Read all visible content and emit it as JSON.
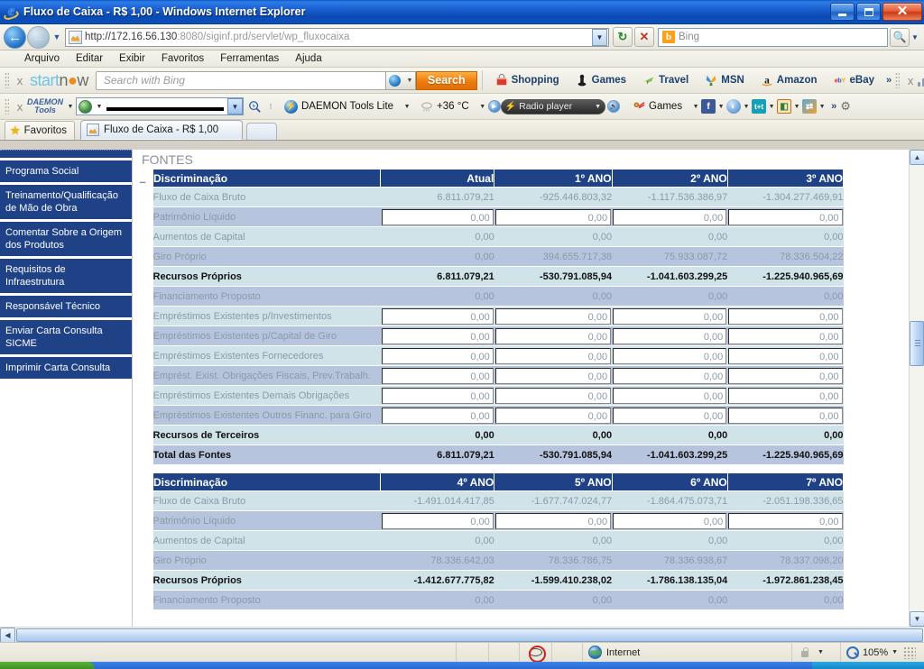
{
  "window": {
    "title": "Fluxo de Caixa - R$ 1,00 - Windows Internet Explorer",
    "minimize_label": "",
    "maximize_label": "",
    "close_label": "✕"
  },
  "address_bar": {
    "url_main": "http://172.16.56.130",
    "url_dim": ":8080/siginf.prd/servlet/wp_fluxocaixa",
    "search_placeholder": "Bing"
  },
  "menu": {
    "items": [
      "Arquivo",
      "Editar",
      "Exibir",
      "Favoritos",
      "Ferramentas",
      "Ajuda"
    ]
  },
  "toolbar_startnow": {
    "close_label": "x",
    "brand_part1": "start",
    "brand_part2": "n",
    "brand_o": "●",
    "brand_part3": "w",
    "search_placeholder": "Search with Bing",
    "search_button": "Search",
    "links": [
      {
        "label": "Shopping",
        "icon": "shopping-bag-icon"
      },
      {
        "label": "Games",
        "icon": "joystick-icon"
      },
      {
        "label": "Travel",
        "icon": "plane-icon"
      },
      {
        "label": "MSN",
        "icon": "msn-butterfly-icon"
      },
      {
        "label": "Amazon",
        "icon": "amazon-a-icon"
      },
      {
        "label": "eBay",
        "icon": "ebay-icon"
      }
    ],
    "overflow": "»",
    "right_close": "x"
  },
  "toolbar_daemon": {
    "close_label": "x",
    "brand_line1": "DAEMON",
    "brand_line2": "Tools",
    "field_value": "",
    "lite_label": "DAEMON Tools Lite",
    "temperature": "+36 °C",
    "radio_label": "Radio player",
    "games_label": "Games",
    "overflow": "»",
    "tiles": [
      "f",
      "◐",
      "t+t",
      "◧",
      "⇄"
    ]
  },
  "favorites_bar": {
    "favorites_label": "Favoritos",
    "tab_title": "Fluxo de Caixa - R$ 1,00",
    "new_tab_label": ""
  },
  "sidebar": {
    "items": [
      {
        "label": "",
        "partial": true
      },
      {
        "label": "Programa Social"
      },
      {
        "label": "Treinamento/Qualificação de Mão de Obra"
      },
      {
        "label": "Comentar Sobre a Origem dos Produtos"
      },
      {
        "label": "Requisitos de Infraestrutura"
      },
      {
        "label": "Responsável Técnico"
      },
      {
        "label": "Enviar Carta Consulta SICME"
      },
      {
        "label": "Imprimir Carta Consulta"
      }
    ]
  },
  "page": {
    "section_label": "FONTES",
    "collapse_mark": "–",
    "label_column_header": "Discriminação",
    "tables": [
      {
        "headers": [
          "Discriminação",
          "Atual",
          "1º ANO",
          "2º ANO",
          "3º ANO"
        ],
        "rows": [
          {
            "label": "Fluxo de Caixa Bruto",
            "values": [
              "6.811.079,21",
              "-925.446.803,32",
              "-1.117.536.386,97",
              "-1.304.277.469,91"
            ],
            "input": false,
            "bold": false
          },
          {
            "label": "Patrimônio Líquido",
            "values": [
              "0,00",
              "0,00",
              "0,00",
              "0,00"
            ],
            "input": true,
            "bold": false
          },
          {
            "label": "Aumentos de Capital",
            "values": [
              "0,00",
              "0,00",
              "0,00",
              "0,00"
            ],
            "input": false,
            "bold": false
          },
          {
            "label": "Giro Próprio",
            "values": [
              "0,00",
              "394.655.717,38",
              "75.933.087,72",
              "78.336.504,22"
            ],
            "input": false,
            "bold": false
          },
          {
            "label": "Recursos Próprios",
            "values": [
              "6.811.079,21",
              "-530.791.085,94",
              "-1.041.603.299,25",
              "-1.225.940.965,69"
            ],
            "input": false,
            "bold": true
          },
          {
            "label": "Financiamento Proposto",
            "values": [
              "0,00",
              "0,00",
              "0,00",
              "0,00"
            ],
            "input": false,
            "bold": false
          },
          {
            "label": "Empréstimos Existentes p/Investimentos",
            "values": [
              "0,00",
              "0,00",
              "0,00",
              "0,00"
            ],
            "input": true,
            "bold": false
          },
          {
            "label": "Empréstimos Existentes p/Capital de Giro",
            "values": [
              "0,00",
              "0,00",
              "0,00",
              "0,00"
            ],
            "input": true,
            "bold": false
          },
          {
            "label": "Empréstimos Existentes Fornecedores",
            "values": [
              "0,00",
              "0,00",
              "0,00",
              "0,00"
            ],
            "input": true,
            "bold": false
          },
          {
            "label": "Emprést. Exist. Obrigações Fiscais, Prev.Trabalh.",
            "values": [
              "0,00",
              "0,00",
              "0,00",
              "0,00"
            ],
            "input": true,
            "bold": false
          },
          {
            "label": "Empréstimos Existentes Demais Obrigações",
            "values": [
              "0,00",
              "0,00",
              "0,00",
              "0,00"
            ],
            "input": true,
            "bold": false
          },
          {
            "label": "Empréstimos Existentes Outros Financ. para Giro",
            "values": [
              "0,00",
              "0,00",
              "0,00",
              "0,00"
            ],
            "input": true,
            "bold": false
          },
          {
            "label": "Recursos de Terceiros",
            "values": [
              "0,00",
              "0,00",
              "0,00",
              "0,00"
            ],
            "input": false,
            "bold": true
          },
          {
            "label": "Total das Fontes",
            "values": [
              "6.811.079,21",
              "-530.791.085,94",
              "-1.041.603.299,25",
              "-1.225.940.965,69"
            ],
            "input": false,
            "bold": true,
            "total": true
          }
        ]
      },
      {
        "headers": [
          "Discriminação",
          "4º ANO",
          "5º ANO",
          "6º ANO",
          "7º ANO"
        ],
        "rows": [
          {
            "label": "Fluxo de Caixa Bruto",
            "values": [
              "-1.491.014.417,85",
              "-1.677.747.024,77",
              "-1.864.475.073,71",
              "-2.051.198.336,65"
            ],
            "input": false,
            "bold": false
          },
          {
            "label": "Patrimônio Líquido",
            "values": [
              "0,00",
              "0,00",
              "0,00",
              "0,00"
            ],
            "input": true,
            "bold": false
          },
          {
            "label": "Aumentos de Capital",
            "values": [
              "0,00",
              "0,00",
              "0,00",
              "0,00"
            ],
            "input": false,
            "bold": false
          },
          {
            "label": "Giro Próprio",
            "values": [
              "78.336.642,03",
              "78.336.786,75",
              "78.336.938,67",
              "78.337.098,20"
            ],
            "input": false,
            "bold": false
          },
          {
            "label": "Recursos Próprios",
            "values": [
              "-1.412.677.775,82",
              "-1.599.410.238,02",
              "-1.786.138.135,04",
              "-1.972.861.238,45"
            ],
            "input": false,
            "bold": true
          },
          {
            "label": "Financiamento Proposto",
            "values": [
              "0,00",
              "0,00",
              "0,00",
              "0,00"
            ],
            "input": false,
            "bold": false
          }
        ]
      }
    ]
  },
  "status_bar": {
    "zone_label": "Internet",
    "zoom_level": "105%",
    "caret": "▼"
  }
}
